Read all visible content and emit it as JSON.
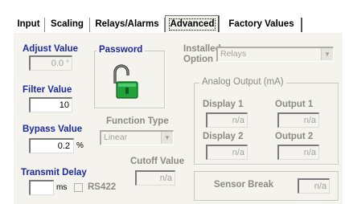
{
  "tabs": [
    {
      "label": "Input"
    },
    {
      "label": "Scaling"
    },
    {
      "label": "Relays/Alarms"
    },
    {
      "label": "Advanced"
    },
    {
      "label": "Factory Values"
    }
  ],
  "adjust": {
    "label": "Adjust Value",
    "value": "0.0",
    "unit": "°"
  },
  "filter": {
    "label": "Filter Value",
    "value": "10"
  },
  "bypass": {
    "label": "Bypass Value",
    "value": "0.2",
    "unit": "%"
  },
  "transmit": {
    "label": "Transmit Delay",
    "value": "",
    "unit": "ms",
    "rs422_label": "RS422"
  },
  "password": {
    "label": "Password",
    "icon": "open-padlock-icon"
  },
  "function_type": {
    "label": "Function Type",
    "value": "Linear"
  },
  "cutoff": {
    "label": "Cutoff Value",
    "value": "n/a"
  },
  "installed_option": {
    "label_line1": "Installed",
    "label_line2": "Option",
    "value": "Relays"
  },
  "analog_output": {
    "label": "Analog Output (mA)",
    "display1": {
      "label": "Display 1",
      "value": "n/a"
    },
    "output1": {
      "label": "Output 1",
      "value": "n/a"
    },
    "display2": {
      "label": "Display 2",
      "value": "n/a"
    },
    "output2": {
      "label": "Output 2",
      "value": "n/a"
    }
  },
  "sensor_break": {
    "label": "Sensor Break",
    "value": "n/a"
  },
  "colors": {
    "accent_blue": "#1c2a9c",
    "disabled_gray": "#8c8a80",
    "lock_green": "#1fa33a",
    "panel_bg": "#f4f3ee"
  }
}
